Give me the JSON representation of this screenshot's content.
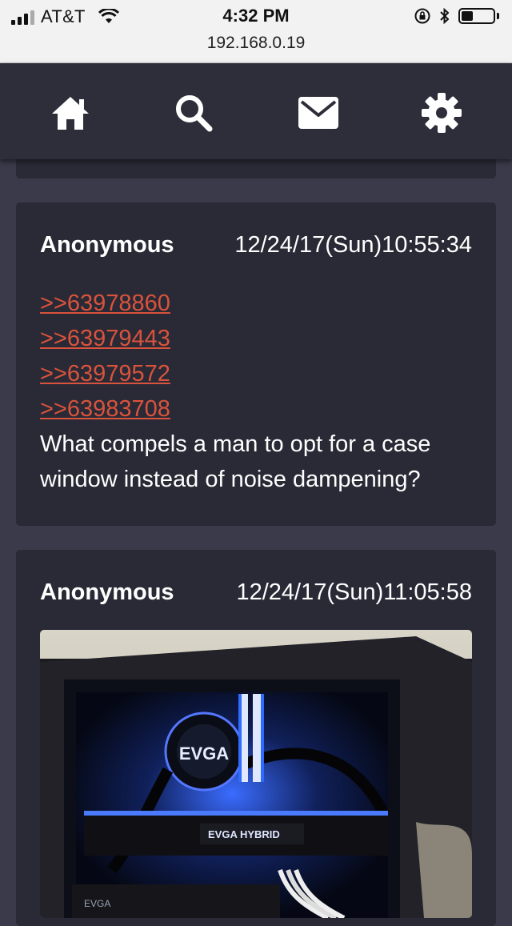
{
  "status_bar": {
    "carrier": "AT&T",
    "time": "4:32 PM",
    "url": "192.168.0.19"
  },
  "nav": {
    "home_icon": "home-icon",
    "search_icon": "search-icon",
    "mail_icon": "mail-icon",
    "settings_icon": "gear-icon"
  },
  "posts": [
    {
      "author": "Anonymous",
      "datetime": "12/24/17(Sun)10:55:34",
      "reply_links": [
        ">>63978860",
        ">>63979443",
        ">>63979572",
        ">>63983708"
      ],
      "text": "What compels a man to opt for a case window instead of noise dampening?"
    },
    {
      "author": "Anonymous",
      "datetime": "12/24/17(Sun)11:05:58",
      "image_labels": [
        "EVGA",
        "EVGA HYBRID",
        "EVGA"
      ]
    }
  ],
  "colors": {
    "background": "#3a3a4a",
    "post_background": "#2a2a36",
    "navbar": "#2e2e3b",
    "link": "#d9533c"
  }
}
